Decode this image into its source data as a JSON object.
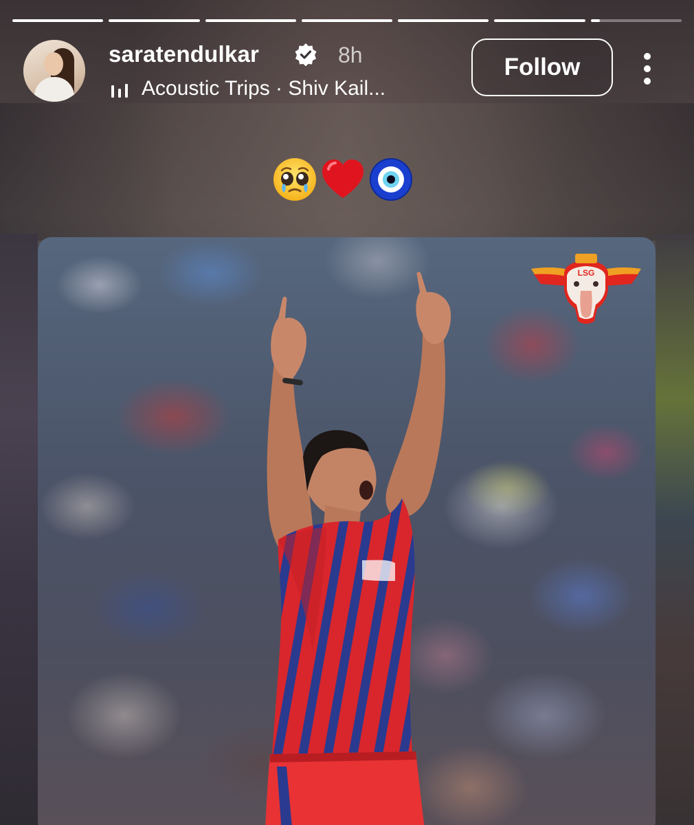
{
  "progress": {
    "segments": [
      1,
      1,
      1,
      1,
      1,
      1,
      0.1
    ]
  },
  "header": {
    "username": "saratendulkar",
    "verified": true,
    "time": "8h",
    "music": {
      "icon": "music-bars-icon",
      "text": "Acoustic Trips · Shiv Kail..."
    },
    "follow_label": "Follow",
    "more_icon": "more-vertical-icon"
  },
  "sticker": {
    "emojis": [
      "pleading-face-emoji",
      "red-heart-emoji",
      "nazar-amulet-emoji"
    ]
  },
  "post": {
    "description": "Reposted photo of a cricketer in a red and blue striped jersey celebrating with both arms raised",
    "logo": "lsg-team-logo",
    "logo_text": "LSG"
  },
  "colors": {
    "accent": "#ffffff",
    "jersey_red": "#d8262c",
    "jersey_blue": "#2a3a8f"
  }
}
